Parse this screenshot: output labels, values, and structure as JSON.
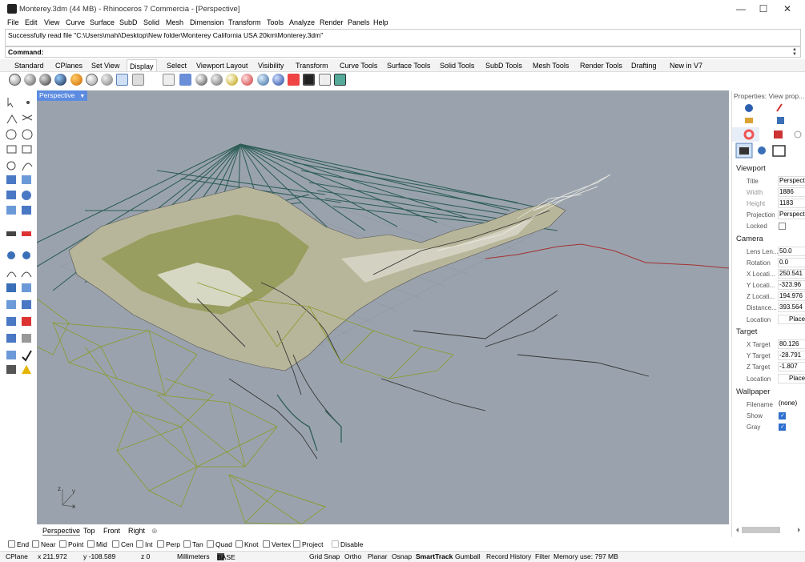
{
  "window": {
    "title": "Monterey.3dm (44 MB) - Rhinoceros 7 Commercia - [Perspective]",
    "minimize": "—",
    "maximize": "☐",
    "close": "✕"
  },
  "menu": [
    "File",
    "Edit",
    "View",
    "Curve",
    "Surface",
    "SubD",
    "Solid",
    "Mesh",
    "Dimension",
    "Transform",
    "Tools",
    "Analyze",
    "Render",
    "Panels",
    "Help"
  ],
  "command_history": "Successfully read file \"C:\\Users\\mahi\\Desktop\\New folder\\Monterey California USA 20km\\Monterey.3dm\"",
  "command_label": "Command:",
  "toolbar_tabs": [
    "Standard",
    "CPlanes",
    "Set View",
    "Display",
    "Select",
    "Viewport Layout",
    "Visibility",
    "Transform",
    "Curve Tools",
    "Surface Tools",
    "Solid Tools",
    "SubD Tools",
    "Mesh Tools",
    "Render Tools",
    "Drafting",
    "New in V7"
  ],
  "active_toolbar_tab": "Display",
  "viewport": {
    "active_name": "Perspective",
    "tabs": [
      "Perspective",
      "Top",
      "Front",
      "Right"
    ],
    "add_tab_icon": "⊕",
    "axis_labels": {
      "z": "z",
      "y": "y",
      "x": "x"
    }
  },
  "properties": {
    "header": "Properties: View prop...",
    "sections": {
      "viewport": "Viewport",
      "camera": "Camera",
      "target": "Target",
      "wallpaper": "Wallpaper"
    },
    "viewport_fields": {
      "title_label": "Title",
      "title_value": "Perspective",
      "width_label": "Width",
      "width_value": "1886",
      "height_label": "Height",
      "height_value": "1183",
      "projection_label": "Projection",
      "projection_value": "Perspective",
      "locked_label": "Locked"
    },
    "camera_fields": {
      "lens_label": "Lens Len...",
      "lens_value": "50.0",
      "rotation_label": "Rotation",
      "rotation_value": "0.0",
      "xloc_label": "X Locati...",
      "xloc_value": "250.541",
      "yloc_label": "Y Locati...",
      "yloc_value": "-323.96",
      "zloc_label": "Z Locati...",
      "zloc_value": "194.976",
      "distance_label": "Distance...",
      "distance_value": "393.564",
      "location_label": "Location",
      "location_button": "Place..."
    },
    "target_fields": {
      "xt_label": "X Target",
      "xt_value": "80.126",
      "yt_label": "Y Target",
      "yt_value": "-28.791",
      "zt_label": "Z Target",
      "zt_value": "-1.807",
      "location_label": "Location",
      "location_button": "Place..."
    },
    "wallpaper_fields": {
      "filename_label": "Filename",
      "filename_value": "(none)",
      "show_label": "Show",
      "show_checked": true,
      "gray_label": "Gray",
      "gray_checked": true
    }
  },
  "osnaps": [
    {
      "label": "End",
      "checked": false
    },
    {
      "label": "Near",
      "checked": false
    },
    {
      "label": "Point",
      "checked": false
    },
    {
      "label": "Mid",
      "checked": false
    },
    {
      "label": "Cen",
      "checked": false
    },
    {
      "label": "Int",
      "checked": false
    },
    {
      "label": "Perp",
      "checked": false
    },
    {
      "label": "Tan",
      "checked": false
    },
    {
      "label": "Quad",
      "checked": false
    },
    {
      "label": "Knot",
      "checked": false
    },
    {
      "label": "Vertex",
      "checked": false
    },
    {
      "label": "Project",
      "checked": false
    },
    {
      "label": "Disable",
      "checked": false
    }
  ],
  "status": {
    "cplane": "CPlane",
    "x": "x 211.972",
    "y": "y -108.589",
    "z": "z 0",
    "units": "Millimeters",
    "layer": "BASE",
    "grid_snap": "Grid Snap",
    "ortho": "Ortho",
    "planar": "Planar",
    "osnap": "Osnap",
    "smarttrack": "SmartTrack",
    "gumball": "Gumball",
    "record_history": "Record History",
    "filter": "Filter",
    "memory": "Memory use: 797 MB"
  },
  "colors": {
    "viewport_bg": "#9aa3ad",
    "active_tab": "#5c8be0",
    "terrain_green": "#8a9a2a",
    "cable_teal": "#2f5e58",
    "road_white": "#e8e8e0",
    "red_line": "#a33030"
  }
}
